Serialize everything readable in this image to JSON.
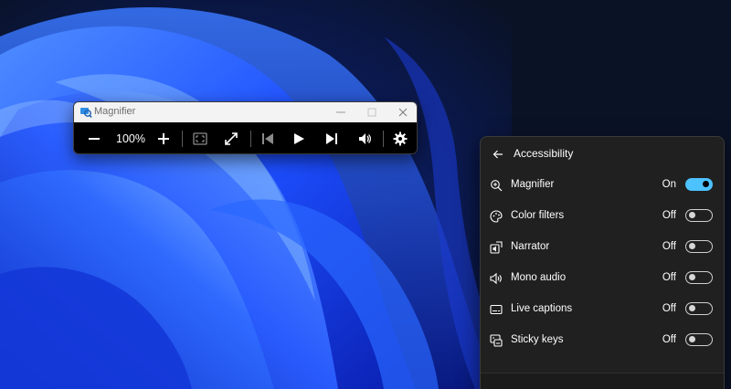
{
  "magnifier": {
    "title": "Magnifier",
    "zoom_level": "100%",
    "toolbar": {
      "zoom_out": "minus-icon",
      "zoom_in": "plus-icon",
      "view": "view-mode-icon",
      "fullscreen": "expand-icon",
      "previous": "skip-previous-icon",
      "play": "play-icon",
      "next": "skip-next-icon",
      "read_from_here": "read-from-here-icon",
      "settings": "gear-icon"
    }
  },
  "accessibility": {
    "title": "Accessibility",
    "items": [
      {
        "label": "Magnifier",
        "state": "On",
        "on": true,
        "icon": "magnifier-icon"
      },
      {
        "label": "Color filters",
        "state": "Off",
        "on": false,
        "icon": "color-filters-icon"
      },
      {
        "label": "Narrator",
        "state": "Off",
        "on": false,
        "icon": "narrator-icon"
      },
      {
        "label": "Mono audio",
        "state": "Off",
        "on": false,
        "icon": "mono-audio-icon"
      },
      {
        "label": "Live captions",
        "state": "Off",
        "on": false,
        "icon": "live-captions-icon"
      },
      {
        "label": "Sticky keys",
        "state": "Off",
        "on": false,
        "icon": "sticky-keys-icon"
      }
    ]
  },
  "colors": {
    "accent": "#4cc2ff",
    "flyout_bg": "#202020",
    "toolbar_bg": "#000000"
  }
}
